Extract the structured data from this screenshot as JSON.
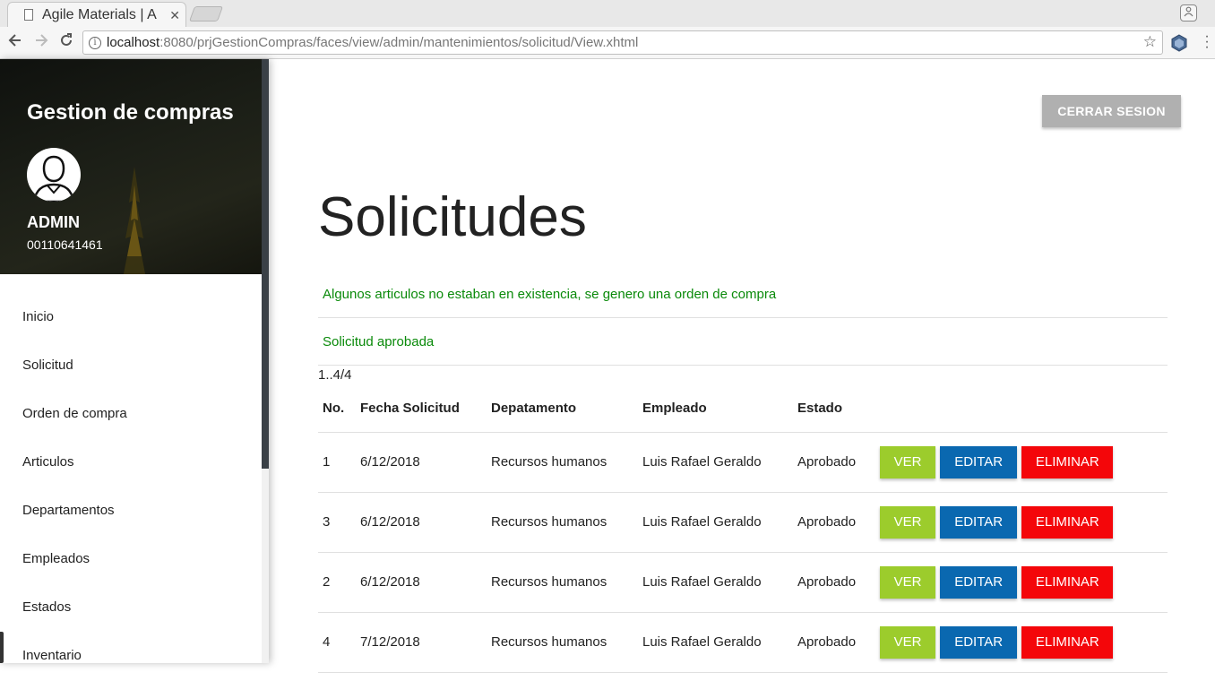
{
  "browser": {
    "tab_title": "Agile Materials | A",
    "tab_close": "✕",
    "url_host": "localhost",
    "url_rest": ":8080/prjGestionCompras/faces/view/admin/mantenimientos/solicitud/View.xhtml"
  },
  "sidebar": {
    "title": "Gestion de compras",
    "user_name": "ADMIN",
    "user_id": "00110641461",
    "items": [
      {
        "label": "Inicio"
      },
      {
        "label": "Solicitud"
      },
      {
        "label": "Orden de compra"
      },
      {
        "label": "Articulos"
      },
      {
        "label": "Departamentos"
      },
      {
        "label": "Empleados"
      },
      {
        "label": "Estados"
      },
      {
        "label": "Inventario"
      }
    ]
  },
  "header": {
    "logout_label": "CERRAR SESION"
  },
  "main": {
    "title": "Solicitudes",
    "messages": [
      "Algunos articulos no estaban en existencia, se genero una orden de compra",
      "Solicitud aprobada"
    ],
    "pager": "1..4/4",
    "columns": [
      "No.",
      "Fecha Solicitud",
      "Depatamento",
      "Empleado",
      "Estado",
      ""
    ],
    "rows": [
      {
        "no": "1",
        "fecha": "6/12/2018",
        "depto": "Recursos humanos",
        "empleado": "Luis Rafael Geraldo",
        "estado": "Aprobado"
      },
      {
        "no": "3",
        "fecha": "6/12/2018",
        "depto": "Recursos humanos",
        "empleado": "Luis Rafael Geraldo",
        "estado": "Aprobado"
      },
      {
        "no": "2",
        "fecha": "6/12/2018",
        "depto": "Recursos humanos",
        "empleado": "Luis Rafael Geraldo",
        "estado": "Aprobado"
      },
      {
        "no": "4",
        "fecha": "7/12/2018",
        "depto": "Recursos humanos",
        "empleado": "Luis Rafael Geraldo",
        "estado": "Aprobado"
      }
    ],
    "actions": {
      "view": "VER",
      "edit": "EDITAR",
      "delete": "ELIMINAR"
    }
  },
  "colors": {
    "view_button": "#9ccc2c",
    "edit_button": "#0a68b0",
    "delete_button": "#f4060a",
    "message_text": "#0a8a0a",
    "logout_button": "#b0b0b0"
  }
}
